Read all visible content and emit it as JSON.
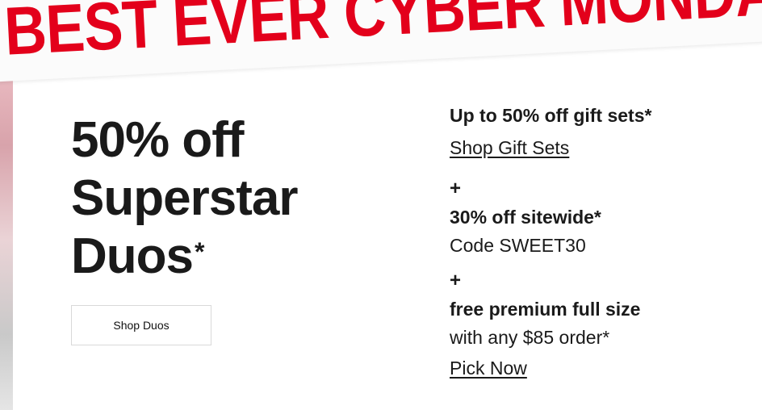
{
  "banner": {
    "text": "BEST EVER CYBER MONDA"
  },
  "promo_left": {
    "headline_line1": "50% off",
    "headline_line2": "Superstar",
    "headline_line3": "Duos",
    "asterisk": "*",
    "button_label": "Shop Duos"
  },
  "promo_right": {
    "offer1_title": "Up to 50% off gift sets*",
    "offer1_link": "Shop Gift Sets",
    "plus1": "+",
    "offer2_title": "30% off sitewide*",
    "offer2_code": "Code SWEET30",
    "plus2": "+",
    "offer3_title": "free premium full size",
    "offer3_detail": "with any $85 order*",
    "offer3_link": "Pick Now"
  },
  "colors": {
    "banner_red": "#e3001b",
    "text_dark": "#1a1a1a"
  }
}
